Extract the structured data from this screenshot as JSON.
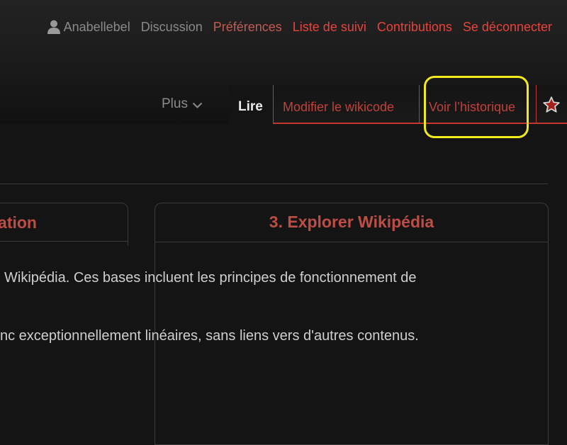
{
  "personal_tools": {
    "username": "Anabellebel",
    "talk": "Discussion",
    "preferences": "Préférences",
    "watchlist": "Liste de suivi",
    "contributions": "Contributions",
    "logout": "Se déconnecter"
  },
  "nav": {
    "more_label": "Plus",
    "tabs": {
      "read": "Lire",
      "edit_source": "Modifier le wikicode",
      "history": "Voir l’historique"
    },
    "watch_icon": "star-icon"
  },
  "content": {
    "left_card_title": "ation",
    "right_card_title": "3. Explorer Wikipédia",
    "paragraph_1": "Wikipédia. Ces bases incluent les principes de fonctionnement de",
    "paragraph_2": "nc exceptionnellement linéaires, sans liens vers d'autres contenus."
  },
  "colors": {
    "background": "#141414",
    "link_red": "#e8433c",
    "tab_border": "#c2372f",
    "highlight": "#f2ea1a"
  }
}
